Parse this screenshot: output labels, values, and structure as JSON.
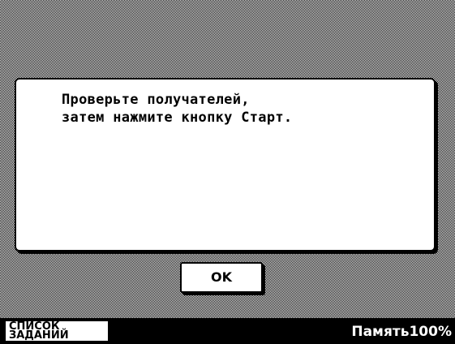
{
  "dialog": {
    "message_lines": [
      "Проверьте получателей,",
      "затем нажмите кнопку Старт."
    ],
    "ok_label": "OK"
  },
  "status_bar": {
    "job_list_lines": [
      "СПИСОК",
      "ЗАДАНИЙ"
    ],
    "memory_text": "Память100%"
  }
}
